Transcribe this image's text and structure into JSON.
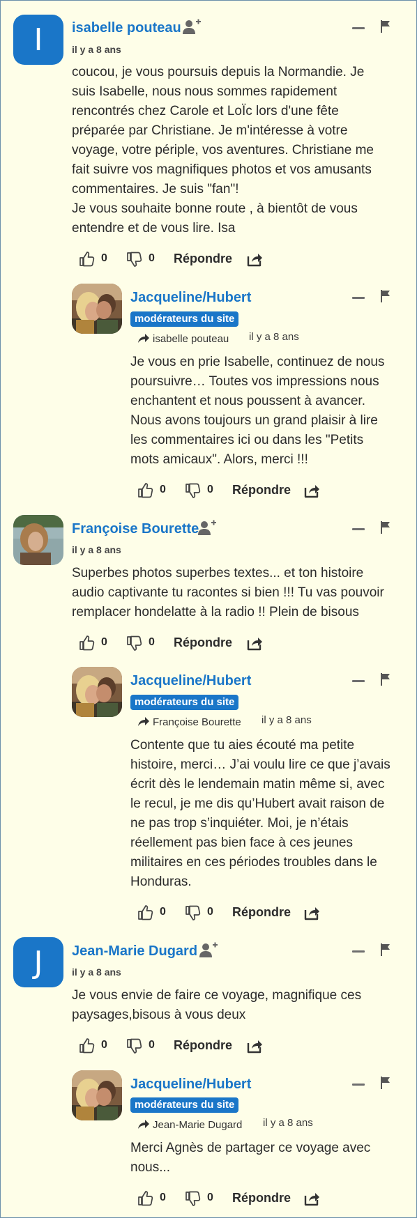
{
  "comments": [
    {
      "author": "isabelle pouteau",
      "avatar_letter": "I",
      "time": "il y a 8 ans",
      "text": "coucou, je vous poursuis depuis la Normandie. Je\nsuis Isabelle, nous nous sommes rapidement\nrencontrés chez Carole et LoÏc lors d'une fête\npréparée par Christiane. Je m'intéresse à votre\nvoyage, votre périple, vos aventures. Christiane me\nfait suivre vos magnifiques photos et vos amusants\ncommentaires. Je suis \"fan\"!\nJe vous souhaite bonne route , à bientôt de vous\nentendre et de vous lire. Isa",
      "likes": "0",
      "dislikes": "0",
      "reply_label": "Répondre",
      "replies": [
        {
          "author": "Jacqueline/Hubert",
          "badge": "modérateurs du site",
          "reply_to": "isabelle pouteau",
          "time": "il y a 8 ans",
          "text": "Je vous en prie Isabelle, continuez de nous\npoursuivre… Toutes vos impressions nous\nenchantent et nous poussent à avancer.\nNous avons toujours un grand plaisir à lire\nles commentaires ici ou dans les \"Petits\nmots amicaux\". Alors, merci !!!",
          "likes": "0",
          "dislikes": "0",
          "reply_label": "Répondre"
        }
      ]
    },
    {
      "author": "Françoise Bourette",
      "time": "il y a 8 ans",
      "text": "Superbes photos superbes textes... et ton histoire\naudio captivante tu racontes si bien !!! Tu vas pouvoir\nremplacer hondelatte à la radio !! Plein de bisous",
      "likes": "0",
      "dislikes": "0",
      "reply_label": "Répondre",
      "replies": [
        {
          "author": "Jacqueline/Hubert",
          "badge": "modérateurs du site",
          "reply_to": "Françoise Bourette",
          "time": "il y a 8 ans",
          "text": "Contente que tu aies écouté ma petite\nhistoire, merci… J’ai voulu lire ce que j’avais\nécrit dès le lendemain matin même si, avec\nle recul, je me dis qu’Hubert avait raison de\nne pas trop s’inquiéter. Moi, je n’étais\nréellement pas bien face à ces jeunes\nmilitaires en ces périodes troubles dans le\nHonduras.",
          "likes": "0",
          "dislikes": "0",
          "reply_label": "Répondre"
        }
      ]
    },
    {
      "author": "Jean-Marie Dugard",
      "avatar_letter": "J",
      "time": "il y a 8 ans",
      "text": "Je vous envie de faire ce voyage, magnifique ces\npaysages,bisous à vous deux",
      "likes": "0",
      "dislikes": "0",
      "reply_label": "Répondre",
      "replies": [
        {
          "author": "Jacqueline/Hubert",
          "badge": "modérateurs du site",
          "reply_to": "Jean-Marie Dugard",
          "time": "il y a 8 ans",
          "text": "Merci Agnès de partager ce voyage avec\nnous...",
          "likes": "0",
          "dislikes": "0",
          "reply_label": "Répondre"
        }
      ]
    }
  ],
  "colors": {
    "accent": "#1a76c8",
    "background": "#fefee8",
    "text": "#2b2b2b",
    "border": "#6b8faa"
  }
}
